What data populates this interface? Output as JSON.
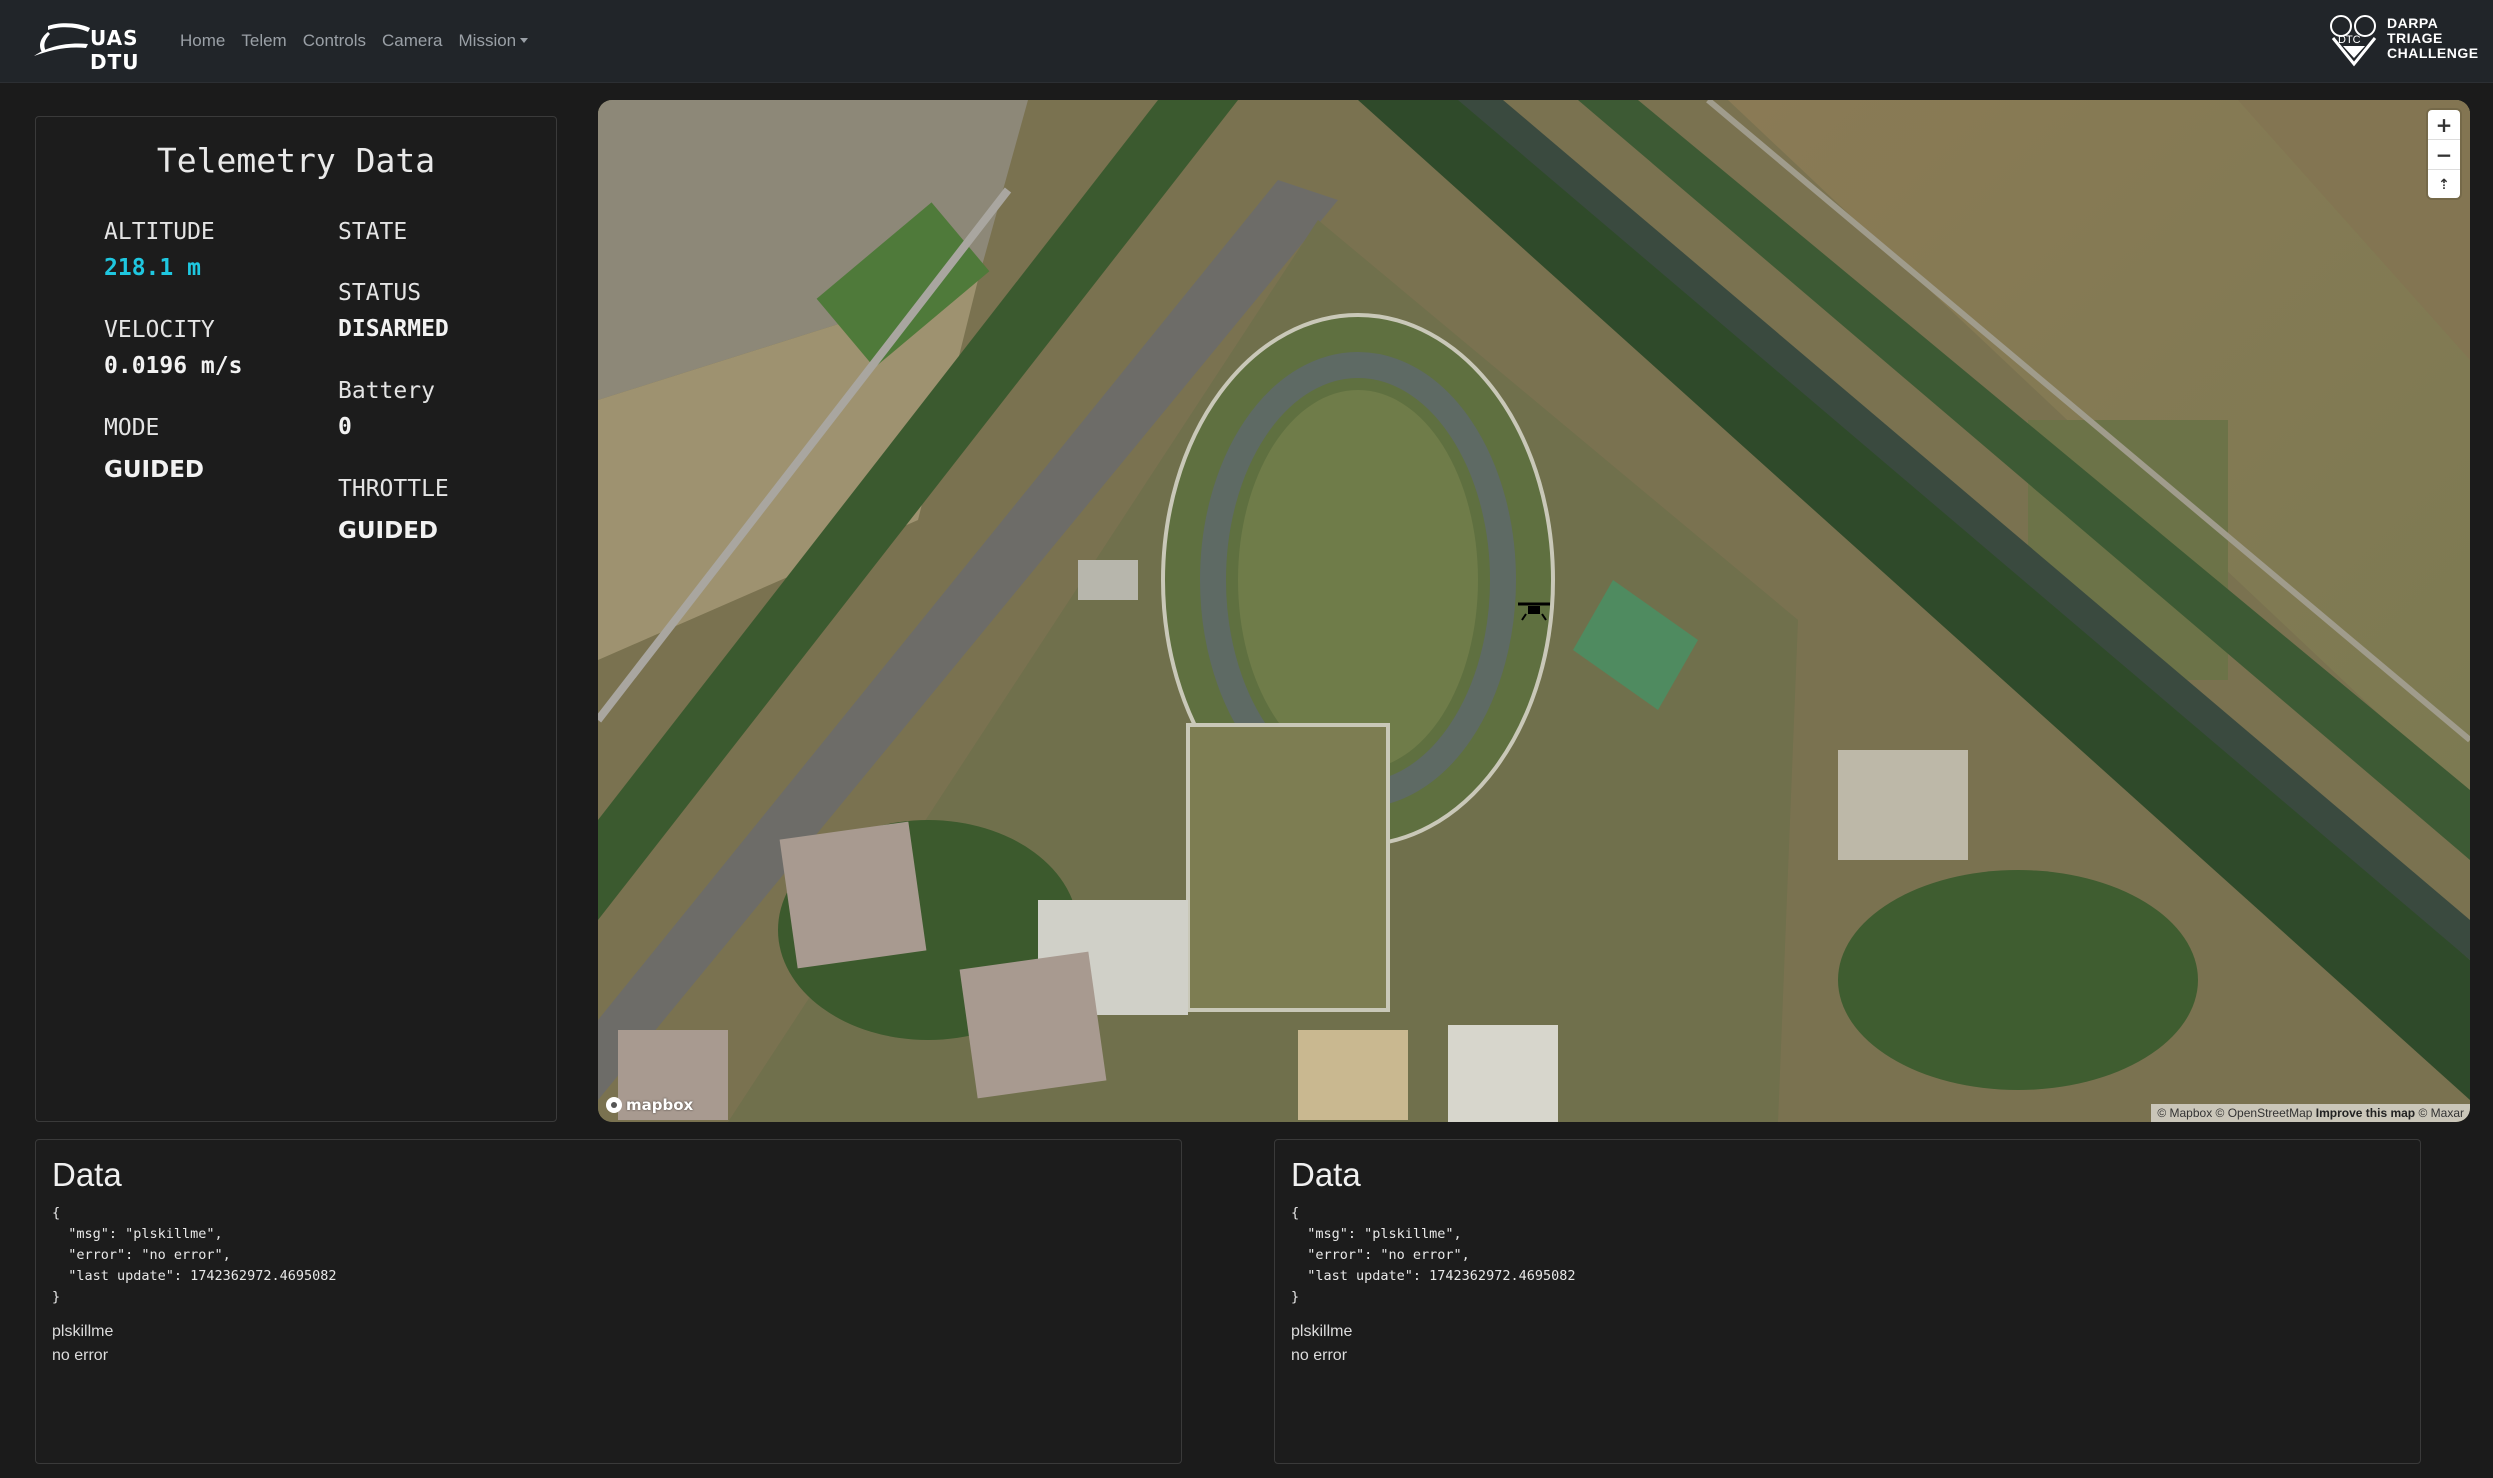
{
  "nav": {
    "brand": "UAS DTU",
    "links": [
      "Home",
      "Telem",
      "Controls",
      "Camera",
      "Mission"
    ],
    "partner_logo_lines": [
      "DARPA",
      "TRIAGE",
      "CHALLENGE"
    ],
    "partner_logo_small": "DTC"
  },
  "telemetry": {
    "title": "Telemetry Data",
    "altitude_label": "ALTITUDE",
    "altitude_value": "218.1 m",
    "velocity_label": "VELOCITY",
    "velocity_value": "0.0196 m/s",
    "mode_label": "MODE",
    "mode_value": "GUIDED",
    "state_label": "STATE",
    "status_label": "STATUS",
    "status_value": "DISARMED",
    "battery_label": "Battery",
    "battery_value": "0",
    "throttle_label": "THROTTLE",
    "throttle_value": "GUIDED"
  },
  "map": {
    "zoom_in": "+",
    "zoom_out": "−",
    "compass": "⇡",
    "logo": "mapbox",
    "attribution": {
      "mapbox": "© Mapbox",
      "osm": "© OpenStreetMap",
      "improve": "Improve this map",
      "maxar": "© Maxar"
    }
  },
  "data_panels": [
    {
      "title": "Data",
      "json_lines": [
        "{",
        "  \"msg\": \"plskillme\",",
        "  \"error\": \"no error\",",
        "  \"last update\": 1742362972.4695082",
        "}"
      ],
      "msg": "plskillme",
      "error": "no error"
    },
    {
      "title": "Data",
      "json_lines": [
        "{",
        "  \"msg\": \"plskillme\",",
        "  \"error\": \"no error\",",
        "  \"last update\": 1742362972.4695082",
        "}"
      ],
      "msg": "plskillme",
      "error": "no error"
    }
  ],
  "colors": {
    "background": "#1b1b1b",
    "navbar": "#212529",
    "accent_cyan": "#1fc7e0"
  }
}
